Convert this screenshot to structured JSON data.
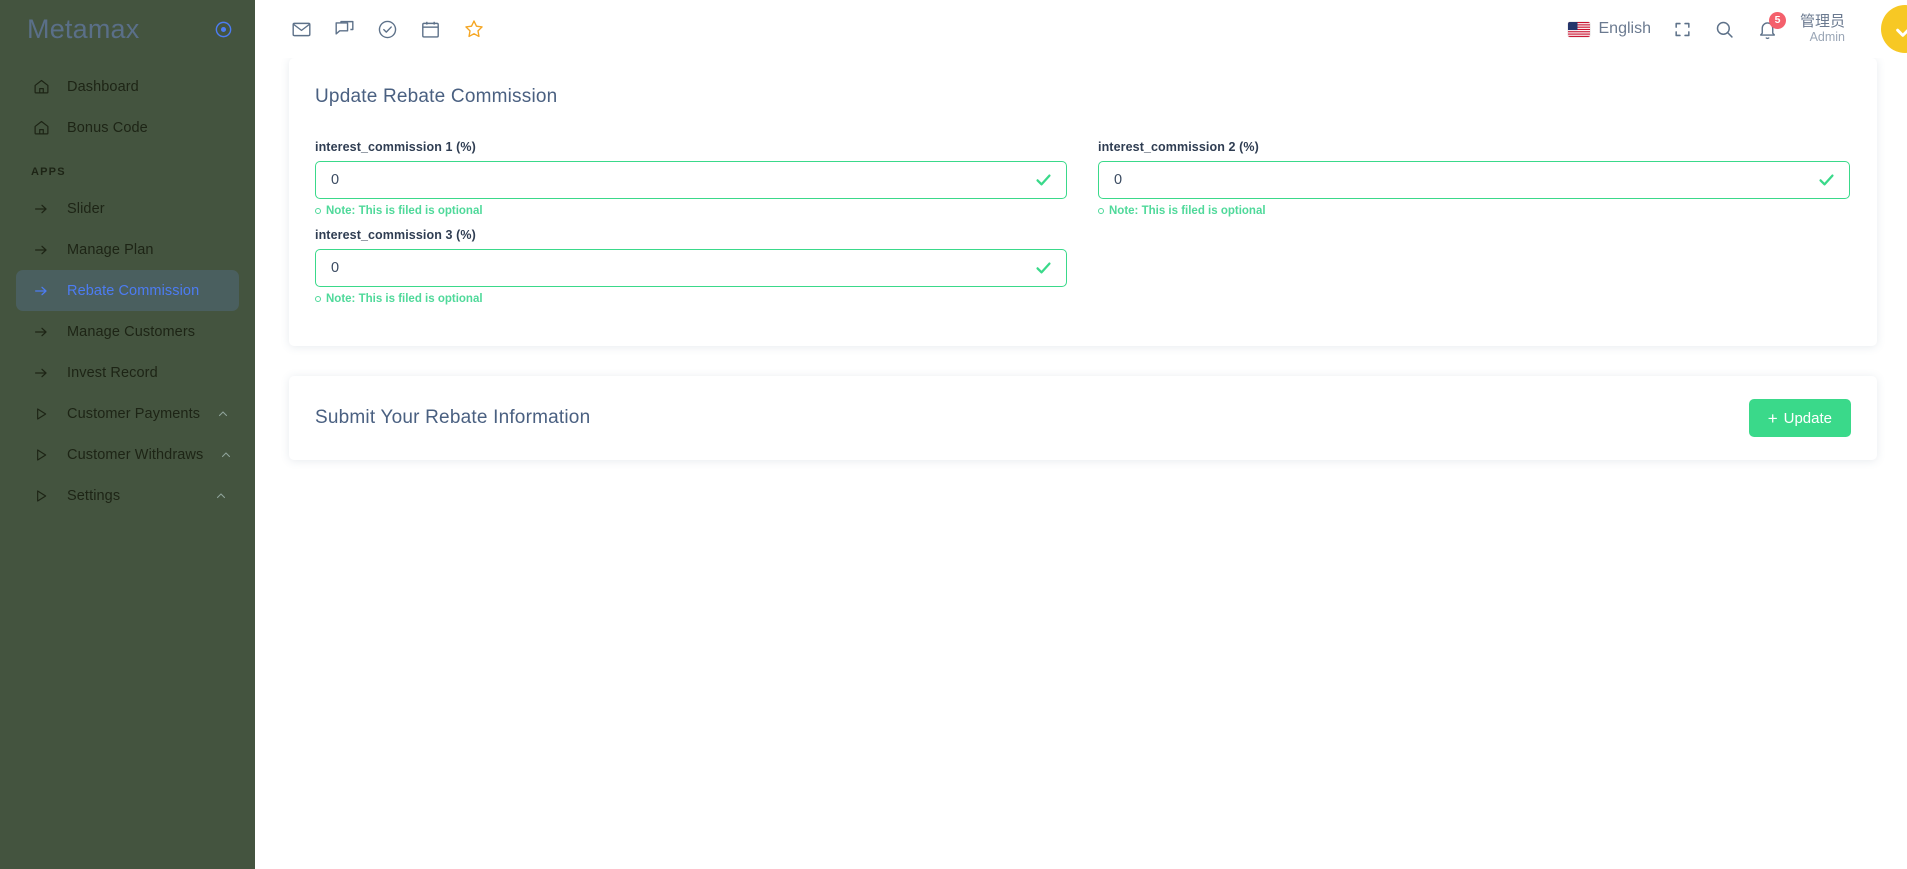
{
  "sidebar": {
    "brand": "Metamax",
    "brand_icon": "target-circle-icon",
    "top_items": [
      {
        "label": "Dashboard",
        "icon": "home-icon"
      },
      {
        "label": "Bonus Code",
        "icon": "home-icon"
      }
    ],
    "section_label": "APPS",
    "app_items": [
      {
        "label": "Slider",
        "icon": "arrow-right-icon",
        "active": false,
        "expandable": false
      },
      {
        "label": "Manage Plan",
        "icon": "arrow-right-icon",
        "active": false,
        "expandable": false
      },
      {
        "label": "Rebate Commission",
        "icon": "arrow-right-icon",
        "active": true,
        "expandable": false
      },
      {
        "label": "Manage Customers",
        "icon": "arrow-right-icon",
        "active": false,
        "expandable": false
      },
      {
        "label": "Invest Record",
        "icon": "arrow-right-icon",
        "active": false,
        "expandable": false
      },
      {
        "label": "Customer Payments",
        "icon": "play-triangle-icon",
        "active": false,
        "expandable": true
      },
      {
        "label": "Customer Withdraws",
        "icon": "play-triangle-icon",
        "active": false,
        "expandable": true
      },
      {
        "label": "Settings",
        "icon": "play-triangle-icon",
        "active": false,
        "expandable": true
      }
    ]
  },
  "topbar": {
    "left_icons": [
      {
        "name": "mail-icon"
      },
      {
        "name": "chat-icon"
      },
      {
        "name": "check-circle-icon"
      },
      {
        "name": "calendar-icon"
      },
      {
        "name": "star-icon"
      }
    ],
    "language": "English",
    "language_flag": "us-flag-icon",
    "fullscreen_icon": "fullscreen-icon",
    "search_icon": "search-icon",
    "notification_icon": "bell-icon",
    "notification_count": "5",
    "user_name": "管理员",
    "user_role": "Admin",
    "avatar_icon": "check-avatar-icon"
  },
  "main": {
    "card_title": "Update Rebate Commission",
    "fields": [
      {
        "label": "interest_commission 1 (%)",
        "value": "0",
        "placeholder": "0",
        "note": "Note: This is filed is optional",
        "valid": true
      },
      {
        "label": "interest_commission 2 (%)",
        "value": "0",
        "placeholder": "0",
        "note": "Note: This is filed is optional",
        "valid": true
      },
      {
        "label": "interest_commission 3 (%)",
        "value": "0",
        "placeholder": "0",
        "note": "Note: This is filed is optional",
        "valid": true
      }
    ],
    "submit_card_title": "Submit Your Rebate Information",
    "update_button_label": "Update",
    "update_button_plus": "+"
  },
  "colors": {
    "sidebar_bg": "#44543f",
    "sidebar_active_bg": "#4a5f5f",
    "sidebar_active_text": "#4c7cf3",
    "accent_green": "#3ad98a",
    "note_green": "#4fd99a",
    "title_blue": "#4a6081",
    "badge_red": "#f4606c",
    "avatar_yellow": "#f7c824",
    "star_orange": "#f5a623"
  }
}
